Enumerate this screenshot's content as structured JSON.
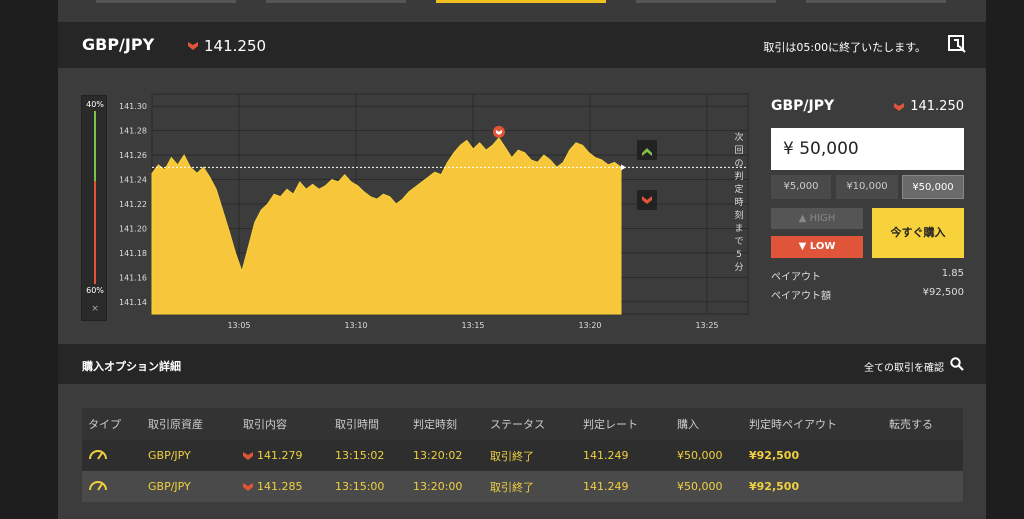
{
  "header": {
    "pair": "GBP/JPY",
    "rate": "141.250",
    "notice": "取引は05:00に終了いたします。"
  },
  "gauge": {
    "top_label": "40%",
    "bottom_label": "60%",
    "close": "×"
  },
  "chart_data": {
    "type": "area",
    "x_ticks": [
      "13:05",
      "13:10",
      "13:15",
      "13:20",
      "13:25"
    ],
    "y_ticks": [
      "141.30",
      "141.28",
      "141.26",
      "141.24",
      "141.22",
      "141.20",
      "141.18",
      "141.16",
      "141.14"
    ],
    "ylim": [
      141.13,
      141.31
    ],
    "current_rate": 141.25,
    "vertical_note": "次回の判定時刻まで5分",
    "series": [
      {
        "values": [
          141.245,
          141.252,
          141.248,
          141.258,
          141.252,
          141.26,
          141.25,
          141.245,
          141.25,
          141.242,
          141.232,
          141.215,
          141.198,
          141.18,
          141.165,
          141.185,
          141.205,
          141.215,
          141.22,
          141.228,
          141.226,
          141.232,
          141.228,
          141.238,
          141.232,
          141.236,
          141.232,
          141.235,
          141.24,
          141.238,
          141.244,
          141.238,
          141.235,
          141.23,
          141.226,
          141.224,
          141.228,
          141.226,
          141.22,
          141.224,
          141.23,
          141.234,
          141.238,
          141.242,
          141.246,
          141.244,
          141.254,
          141.262,
          141.268,
          141.272,
          141.265,
          141.27,
          141.264,
          141.268,
          141.274,
          141.266,
          141.258,
          141.264,
          141.262,
          141.256,
          141.254,
          141.26,
          141.256,
          141.25,
          141.254,
          141.264,
          141.27,
          141.268,
          141.262,
          141.258,
          141.256,
          141.252,
          141.254,
          141.25
        ]
      }
    ],
    "marker_value": 141.279
  },
  "side": {
    "pair": "GBP/JPY",
    "rate": "141.250",
    "amount": "¥ 50,000",
    "presets": [
      "¥5,000",
      "¥10,000",
      "¥50,000"
    ],
    "high": "HIGH",
    "low": "LOW",
    "buy": "今すぐ購入",
    "payout_label": "ペイアウト",
    "payout_value": "1.85",
    "payout_amount_label": "ペイアウト額",
    "payout_amount_value": "¥92,500"
  },
  "details": {
    "title": "購入オプション詳細",
    "link": "全ての取引を確認"
  },
  "table": {
    "headers": [
      "タイプ",
      "取引原資産",
      "取引内容",
      "取引時間",
      "判定時刻",
      "ステータス",
      "判定レート",
      "購入",
      "判定時ペイアウト",
      "転売する"
    ],
    "rows": [
      {
        "asset": "GBP/JPY",
        "rate": "141.279",
        "time": "13:15:02",
        "judge": "13:20:02",
        "status": "取引終了",
        "judge_rate": "141.249",
        "buy": "¥50,000",
        "payout": "¥92,500"
      },
      {
        "asset": "GBP/JPY",
        "rate": "141.285",
        "time": "13:15:00",
        "judge": "13:20:00",
        "status": "取引終了",
        "judge_rate": "141.249",
        "buy": "¥50,000",
        "payout": "¥92,500"
      }
    ]
  },
  "colors": {
    "accent": "#f7d23a",
    "low": "#e0553a",
    "high": "#7fc24a"
  }
}
